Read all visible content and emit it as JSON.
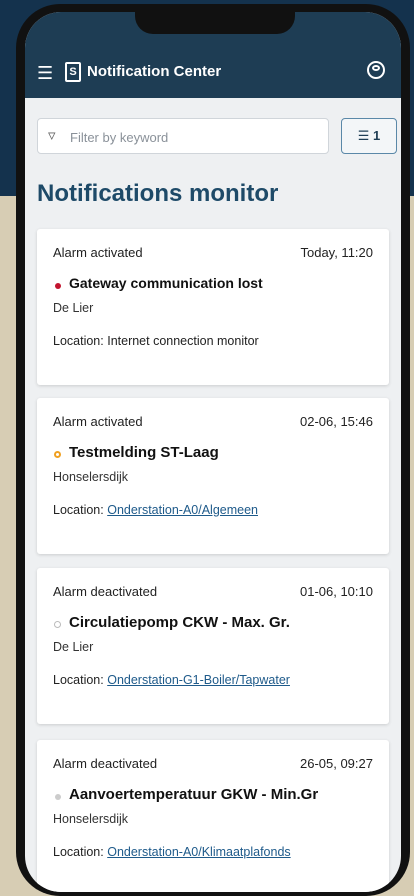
{
  "app": {
    "title": "Notification Center",
    "menu_icon": "hamburger-menu-icon",
    "logo_icon": "document-logo-icon",
    "account_icon": "account-circle-icon"
  },
  "filter": {
    "placeholder": "Filter by keyword",
    "value": "",
    "filter_icon": "funnel-icon",
    "button_icon": "sliders-icon",
    "button_count": "1"
  },
  "page": {
    "title": "Notifications monitor"
  },
  "notifications": [
    {
      "status": "Alarm activated",
      "time": "Today, 11:20",
      "indicator": "red",
      "name": "Gateway communication lost",
      "place": "De Lier",
      "location_label": "Location: ",
      "location": "Internet connection monitor"
    },
    {
      "status": "Alarm activated",
      "time": "02-06, 15:46",
      "indicator": "orange",
      "name": "Testmelding ST-Laag",
      "place": "Honselersdijk",
      "location_label": "Location: ",
      "location": "Onderstation-A0/Algemeen"
    },
    {
      "status": "Alarm deactivated",
      "time": "01-06, 10:10",
      "indicator": "grey-outline",
      "name": "Circulatiepomp CKW - Max. Gr.",
      "place": "De Lier",
      "location_label": "Location: ",
      "location": "Onderstation-G1-Boiler/Tapwater"
    },
    {
      "status": "Alarm deactivated",
      "time": "26-05, 09:27",
      "indicator": "grey",
      "name": "Aanvoertemperatuur GKW - Min.Gr",
      "place": "Honselersdijk",
      "location_label": "Location: ",
      "location": "Onderstation-A0/Klimaatplafonds"
    }
  ],
  "colors": {
    "appbar": "#1e3d54",
    "title": "#1e4a68",
    "alarm_red": "#c2142e",
    "alarm_orange": "#f0a020",
    "link": "#1e5a8a"
  }
}
